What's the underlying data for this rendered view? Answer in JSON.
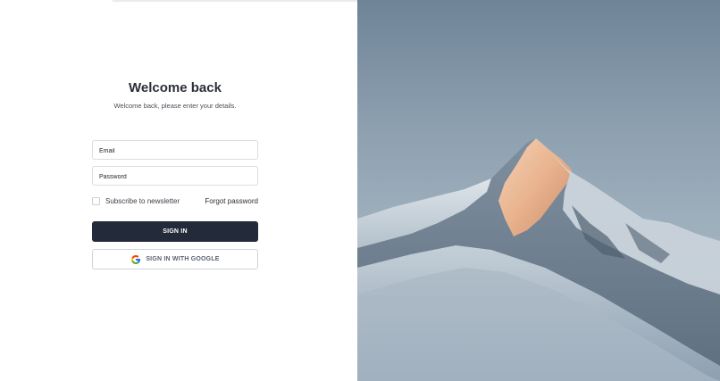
{
  "login": {
    "title": "Welcome back",
    "subtitle": "Welcome back, please enter your details.",
    "email_placeholder": "Email",
    "password_placeholder": "Password",
    "newsletter_label": "Subscribe to newsletter",
    "newsletter_checked": false,
    "forgot_password": "Forgot password",
    "sign_in": "SIGN IN",
    "sign_in_google": "SIGN IN WITH GOOGLE",
    "google_icon": "google-icon"
  },
  "colors": {
    "primary_button": "#232a3a",
    "sky": "#8ea1b1"
  },
  "hero": {
    "image": "snow-mountain-peak"
  }
}
